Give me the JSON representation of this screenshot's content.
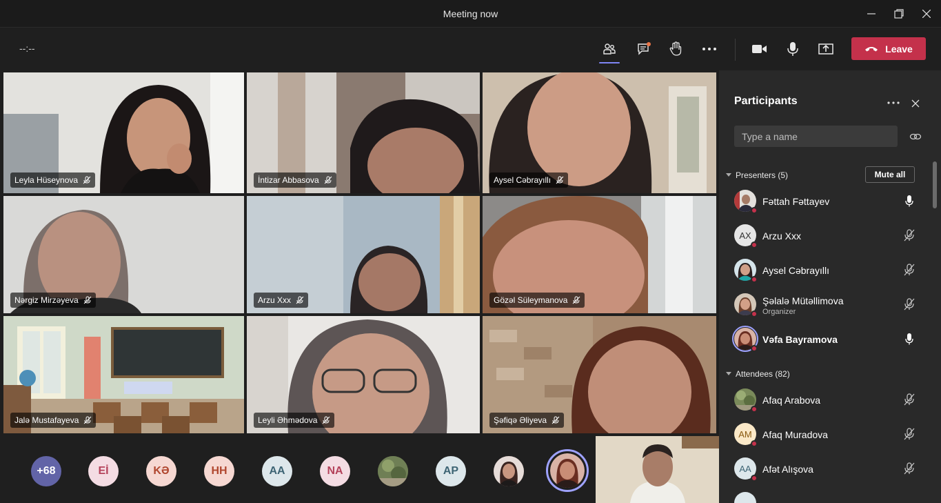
{
  "window": {
    "title": "Meeting now"
  },
  "toolbar": {
    "timer": "--:--",
    "leave_label": "Leave"
  },
  "tiles": [
    {
      "name": "Leyla Hüseynova"
    },
    {
      "name": "İntizar Abbasova"
    },
    {
      "name": "Aysel Cəbrayıllı"
    },
    {
      "name": "Nərgiz Mirzəyeva"
    },
    {
      "name": "Arzu Xxx"
    },
    {
      "name": "Gözəl Süleymanova"
    },
    {
      "name": "Jalə Mustafayeva"
    },
    {
      "name": "Leyli Əhmədova"
    },
    {
      "name": "Şəfiqə Əliyeva"
    }
  ],
  "strip": [
    {
      "label": "+68",
      "bg": "#6264a7",
      "fg": "#ffffff"
    },
    {
      "label": "Eİ",
      "bg": "#f4dce3",
      "fg": "#b4425b"
    },
    {
      "label": "KƏ",
      "bg": "#f6d8d2",
      "fg": "#b0472f"
    },
    {
      "label": "HH",
      "bg": "#f6d8d2",
      "fg": "#b0472f"
    },
    {
      "label": "AA",
      "bg": "#dde7eb",
      "fg": "#3d6474"
    },
    {
      "label": "NA",
      "bg": "#f4dce3",
      "fg": "#b4425b"
    },
    {
      "label": "",
      "bg": "#6a7d4a",
      "fg": "#ffffff"
    },
    {
      "label": "AP",
      "bg": "#dde7eb",
      "fg": "#3d6474"
    },
    {
      "label": "",
      "bg": "#8a5a55",
      "fg": "#ffffff"
    },
    {
      "label": "",
      "bg": "#b56a5c",
      "fg": "#ffffff"
    }
  ],
  "panel": {
    "title": "Participants",
    "search_placeholder": "Type a name",
    "presenters_header": "Presenters (5)",
    "mute_all_label": "Mute all",
    "attendees_header": "Attendees (82)",
    "presenters": [
      {
        "name": "Fəttah Fəttayev",
        "initials": "",
        "mic": "on",
        "role": ""
      },
      {
        "name": "Arzu Xxx",
        "initials": "AX",
        "mic": "off",
        "role": ""
      },
      {
        "name": "Aysel Cəbrayıllı",
        "initials": "",
        "mic": "off",
        "role": ""
      },
      {
        "name": "Şəlalə Mütəllimova",
        "initials": "",
        "mic": "off",
        "role": "Organizer"
      },
      {
        "name": "Vəfa Bayramova",
        "initials": "",
        "mic": "on",
        "role": ""
      }
    ],
    "attendees": [
      {
        "name": "Afaq Arabova",
        "initials": "",
        "mic": "off"
      },
      {
        "name": "Afaq Muradova",
        "initials": "AM",
        "mic": "off"
      },
      {
        "name": "Afət Alışova",
        "initials": "AA",
        "mic": "off"
      }
    ]
  },
  "colors": {
    "accent": "#7f85f5",
    "leave": "#c4314b",
    "panel_bg": "#292929",
    "app_bg": "#1f1f1f"
  }
}
